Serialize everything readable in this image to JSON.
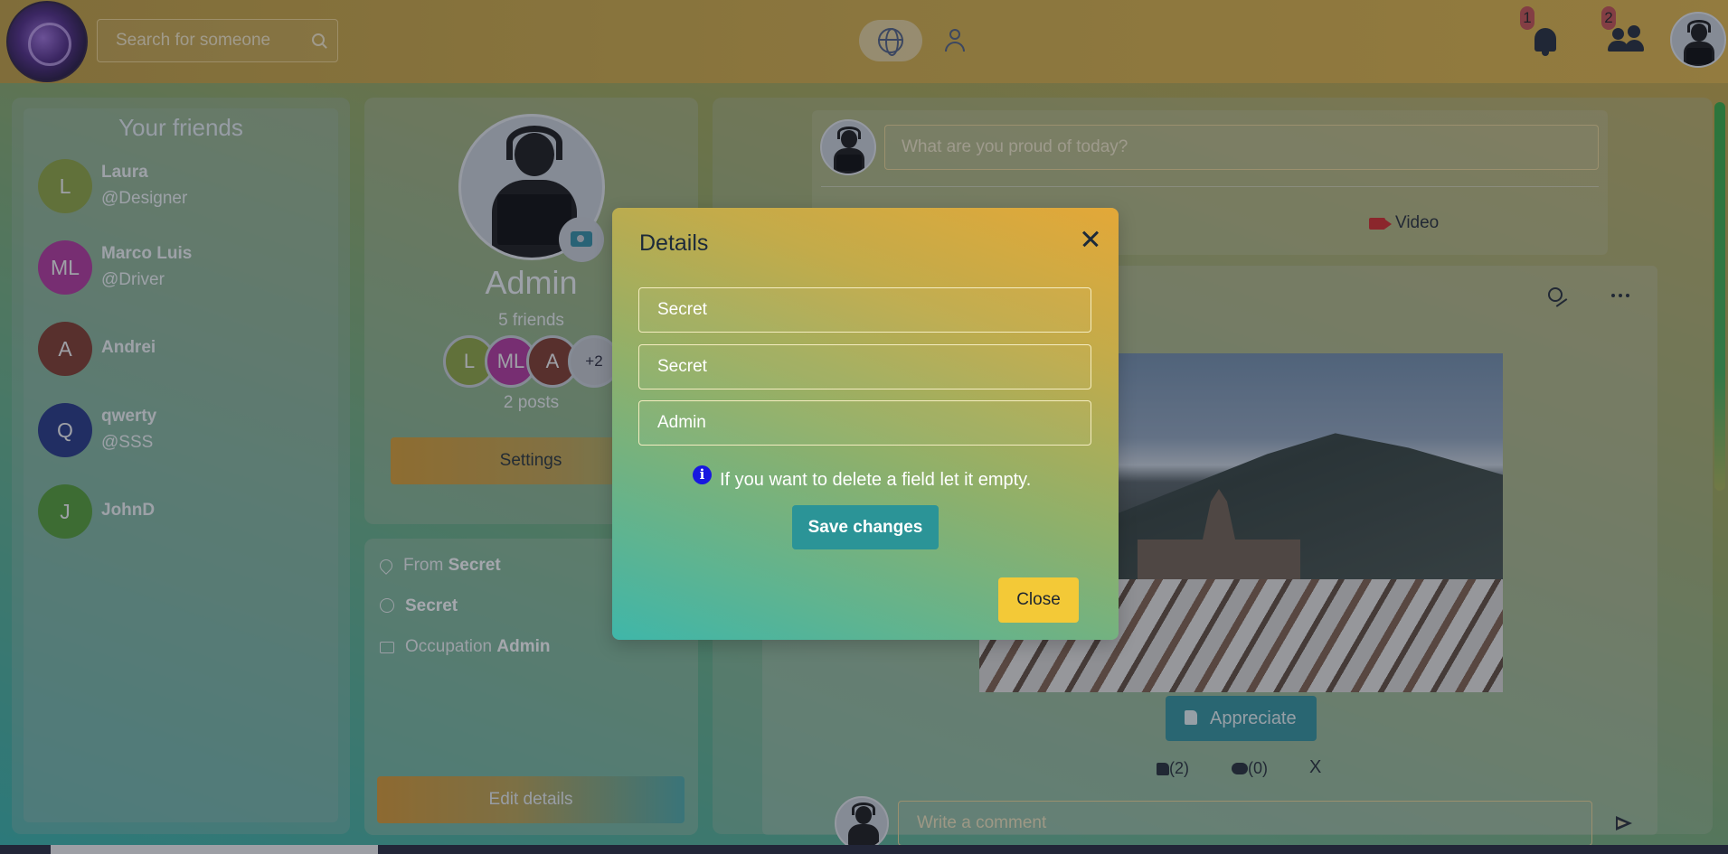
{
  "navbar": {
    "search_placeholder": "Search for someone",
    "notification_count": "1",
    "friend_request_count": "2"
  },
  "friends_panel": {
    "title": "Your friends",
    "friends": [
      {
        "initials": "L",
        "name": "Laura",
        "handle": "@Designer",
        "color": "#8aa33a"
      },
      {
        "initials": "ML",
        "name": "Marco Luis",
        "handle": "@Driver",
        "color": "#b02f9a"
      },
      {
        "initials": "A",
        "name": "Andrei",
        "handle": "",
        "color": "#7a3324"
      },
      {
        "initials": "Q",
        "name": "qwerty",
        "handle": "@SSS",
        "color": "#1c2f80"
      },
      {
        "initials": "J",
        "name": "JohnD",
        "handle": "",
        "color": "#4d9a2e"
      }
    ]
  },
  "profile": {
    "name": "Admin",
    "friends_count": "5 friends",
    "mini_avatars": [
      {
        "label": "L",
        "color": "#8aa33a"
      },
      {
        "label": "ML",
        "color": "#b02f9a"
      },
      {
        "label": "A",
        "color": "#7a3324"
      },
      {
        "label": "+2",
        "color": "#c3c7cc"
      }
    ],
    "posts_count": "2 posts",
    "settings_label": "Settings",
    "from_prefix": "From",
    "from_value": "Secret",
    "website_value": "Secret",
    "occupation_prefix": "Occupation",
    "occupation_value": "Admin",
    "edit_details_label": "Edit details"
  },
  "feed": {
    "composer_placeholder": "What are you proud of today?",
    "video_label": "Video",
    "appreciate_label": "Appreciate",
    "likes": "(2)",
    "comments": "(0)",
    "dismiss_label": "X",
    "comment_placeholder": "Write a comment"
  },
  "modal": {
    "title": "Details",
    "fields": [
      "Secret",
      "Secret",
      "Admin"
    ],
    "info_icon": "i",
    "info_text": "If you want to delete a field let it empty.",
    "save_label": "Save changes",
    "close_label": "Close"
  },
  "colors": {
    "accent_teal": "#2b9497",
    "close_yellow": "#f3c937",
    "badge_red": "#c44a4a"
  }
}
